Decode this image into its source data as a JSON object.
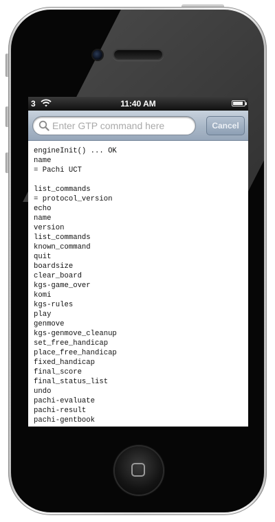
{
  "status_bar": {
    "carrier": "3",
    "time": "11:40 AM",
    "battery_level": 0.9
  },
  "search": {
    "placeholder": "Enter GTP command here",
    "value": "",
    "cancel_label": "Cancel"
  },
  "console": {
    "lines": [
      "engineInit() ... OK",
      "name",
      "= Pachi UCT",
      "",
      "list_commands",
      "= protocol_version",
      "echo",
      "name",
      "version",
      "list_commands",
      "known_command",
      "quit",
      "boardsize",
      "clear_board",
      "kgs-game_over",
      "komi",
      "kgs-rules",
      "play",
      "genmove",
      "kgs-genmove_cleanup",
      "set_free_handicap",
      "place_free_handicap",
      "fixed_handicap",
      "final_score",
      "final_status_list",
      "undo",
      "pachi-evaluate",
      "pachi-result",
      "pachi-gentbook"
    ]
  },
  "icons": {
    "wifi": "wifi-icon",
    "battery": "battery-icon",
    "search": "search-icon",
    "home": "home-button-icon",
    "camera": "camera",
    "speaker": "earpiece-speaker"
  }
}
